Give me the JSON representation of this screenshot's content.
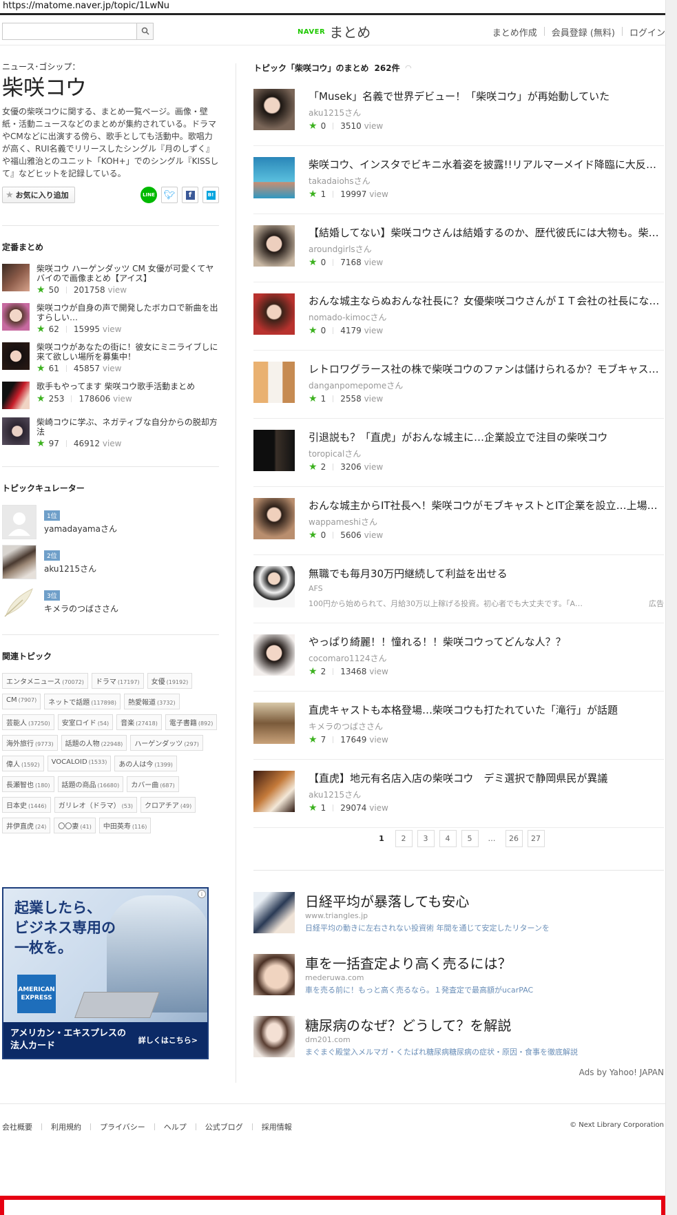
{
  "browser": {
    "url": "https://matome.naver.jp/topic/1LwNu"
  },
  "header": {
    "search": {
      "placeholder": "",
      "value": ""
    },
    "logo_naver": "NAVER",
    "logo_matome": "まとめ",
    "links": [
      "まとめ作成",
      "会員登録 (無料)",
      "ログイン"
    ]
  },
  "topic": {
    "category": "ニュース･ゴシップ：",
    "title": "柴咲コウ",
    "description": "女優の柴咲コウに関する、まとめ一覧ページ。画像・壁紙・活動ニュースなどのまとめが集約されている。ドラマやCMなどに出演する傍ら、歌手としても活動中。歌唱力が高く、RUI名義でリリースしたシングル『月のしずく』や福山雅治とのユニット「KOH+」でのシングル『KISSして』などヒットを記録している。",
    "favorite_label": "お気に入り追加",
    "share": {
      "line": "LINE",
      "twitter": "t",
      "facebook": "f",
      "hatena": "B!"
    }
  },
  "standard": {
    "title": "定番まとめ",
    "items": [
      {
        "title": "柴咲コウ ハーゲンダッツ CM 女優が可愛くてヤバイので画像まとめ【アイス】",
        "stars": "50",
        "views": "201758",
        "view_label": "view"
      },
      {
        "title": "柴咲コウが自身の声で開発したボカロで新曲を出すらしい…",
        "stars": "62",
        "views": "15995",
        "view_label": "view"
      },
      {
        "title": "柴咲コウがあなたの街に！彼女にミニライブしに来て欲しい場所を募集中！",
        "stars": "61",
        "views": "45857",
        "view_label": "view"
      },
      {
        "title": "歌手もやってます 柴咲コウ歌手活動まとめ",
        "stars": "253",
        "views": "178606",
        "view_label": "view"
      },
      {
        "title": "柴崎コウに学ぶ、ネガティブな自分からの脱却方法",
        "stars": "97",
        "views": "46912",
        "view_label": "view"
      }
    ]
  },
  "curators": {
    "title": "トピックキュレーター",
    "items": [
      {
        "rank": "1位",
        "name": "yamadayamaさん"
      },
      {
        "rank": "2位",
        "name": "aku1215さん"
      },
      {
        "rank": "3位",
        "name": "キメラのつばささん"
      }
    ]
  },
  "related": {
    "title": "関連トピック",
    "tags": [
      {
        "name": "エンタメニュース",
        "count": "(70072)"
      },
      {
        "name": "ドラマ",
        "count": "(17197)"
      },
      {
        "name": "女優",
        "count": "(19192)"
      },
      {
        "name": "CM",
        "count": "(7907)"
      },
      {
        "name": "ネットで話題",
        "count": "(117898)"
      },
      {
        "name": "熱愛報道",
        "count": "(3732)"
      },
      {
        "name": "芸能人",
        "count": "(37250)"
      },
      {
        "name": "安室ロイド",
        "count": "(54)"
      },
      {
        "name": "音楽",
        "count": "(27418)"
      },
      {
        "name": "電子書籍",
        "count": "(892)"
      },
      {
        "name": "海外旅行",
        "count": "(9773)"
      },
      {
        "name": "話題の人物",
        "count": "(22948)"
      },
      {
        "name": "ハーゲンダッツ",
        "count": "(297)"
      },
      {
        "name": "偉人",
        "count": "(1592)"
      },
      {
        "name": "VOCALOID",
        "count": "(1533)"
      },
      {
        "name": "あの人は今",
        "count": "(1399)"
      },
      {
        "name": "長瀬智也",
        "count": "(180)"
      },
      {
        "name": "話題の商品",
        "count": "(16680)"
      },
      {
        "name": "カバー曲",
        "count": "(687)"
      },
      {
        "name": "日本史",
        "count": "(1446)"
      },
      {
        "name": "ガリレオ（ドラマ）",
        "count": "(53)"
      },
      {
        "name": "クロアチア",
        "count": "(49)"
      },
      {
        "name": "井伊直虎",
        "count": "(24)"
      },
      {
        "name": "〇〇妻",
        "count": "(41)"
      },
      {
        "name": "中田英寿",
        "count": "(116)"
      }
    ]
  },
  "side_ad": {
    "copy": [
      "起業したら、",
      "ビジネス専用の",
      "一枚を。"
    ],
    "brand": [
      "AMERICAN",
      "EXPRESS"
    ],
    "footer_a": [
      "アメリカン・エキスプレスの",
      "法人カード"
    ],
    "footer_b": "詳しくはこちら>"
  },
  "matome": {
    "header": "トピック「柴咲コウ」のまとめ",
    "count": "262件",
    "items": [
      {
        "title": "「Musek」名義で世界デビュー！「柴咲コウ」が再始動していた",
        "user": "aku1215さん",
        "stars": "0",
        "views": "3510",
        "view_label": "view"
      },
      {
        "title": "柴咲コウ、インスタでビキニ水着姿を披露!!リアルマーメイド降臨に大反響!!",
        "user": "takadaiohsさん",
        "stars": "1",
        "views": "19997",
        "view_label": "view"
      },
      {
        "title": "【結婚してない】柴咲コウさんは結婚するのか、歴代彼氏には大物も。柴咲コウさん…",
        "user": "aroundgirlsさん",
        "stars": "0",
        "views": "7168",
        "view_label": "view"
      },
      {
        "title": "おんな城主ならぬおんな社長に？女優柴咲コウさんがＩＴ会社の社長になっていた",
        "user": "nomado-kimocさん",
        "stars": "0",
        "views": "4179",
        "view_label": "view"
      },
      {
        "title": "レトロワグラース社の株で柴咲コウのファンは儲けられるか？モブキャストとの提携",
        "user": "danganpomepomeさん",
        "stars": "1",
        "views": "2558",
        "view_label": "view"
      },
      {
        "title": "引退説も？「直虎」がおんな城主に…企業設立で注目の柴咲コウ",
        "user": "toropicalさん",
        "stars": "2",
        "views": "3206",
        "view_label": "view"
      },
      {
        "title": "おんな城主からIT社長へ！柴咲コウがモブキャストとIT企業を設立…上場も視野に",
        "user": "wappameshiさん",
        "stars": "0",
        "views": "5606",
        "view_label": "view"
      }
    ],
    "ad_item": {
      "title": "無職でも毎月30万円継続して利益を出せる",
      "source": "AFS",
      "text": "100円から始められて、月給30万以上稼げる投資。初心者でも大丈夫です。「A…",
      "label": "広告"
    },
    "items2": [
      {
        "title": "やっぱり綺麗！！憧れる！！柴咲コウってどんな人？？",
        "user": "cocomaro1124さん",
        "stars": "2",
        "views": "13468",
        "view_label": "view"
      },
      {
        "title": "直虎キャストも本格登場…柴咲コウも打たれていた「滝行」が話題",
        "user": "キメラのつばささん",
        "stars": "7",
        "views": "17649",
        "view_label": "view"
      },
      {
        "title": "【直虎】地元有名店入店の柴咲コウ　デミ選択で静岡県民が異議",
        "user": "aku1215さん",
        "stars": "1",
        "views": "29074",
        "view_label": "view"
      }
    ]
  },
  "pagination": {
    "pages": [
      "1",
      "2",
      "3",
      "4",
      "5",
      "…",
      "26",
      "27"
    ],
    "current": "1"
  },
  "yahoo_ads": {
    "items": [
      {
        "title": "日経平均が暴落しても安心",
        "domain": "www.triangles.jp",
        "text": "日経平均の動きに左右されない投資術 年間を通じて安定したリターンを"
      },
      {
        "title": "車を一括査定より高く売るには？",
        "domain": "mederuwa.com",
        "text": "車を売る前に！もっと高く売るなら。１発査定で最高額がucarPAC"
      },
      {
        "title": "糖尿病のなぜ？どうして？を解説",
        "domain": "dm201.com",
        "text": "まぐまぐ殿堂入メルマガ・くたばれ糖尿病糖尿病の症状・原因・食事を徹底解説"
      }
    ],
    "credit": "Ads by Yahoo! JAPAN"
  },
  "footer": {
    "links": [
      "会社概要",
      "利用規約",
      "プライバシー",
      "ヘルプ",
      "公式ブログ",
      "採用情報"
    ],
    "copyright": "© Next Library Corporation"
  },
  "colors": {
    "star": "#3cb11f",
    "naver": "#1ec800",
    "rank": "#6f9fc9",
    "red_banner": "#e60012"
  }
}
